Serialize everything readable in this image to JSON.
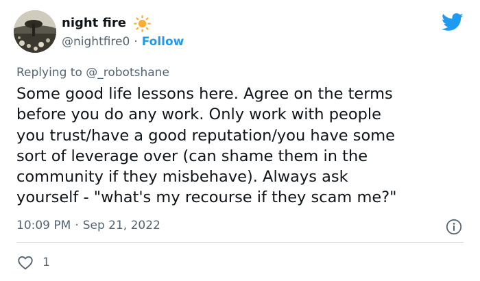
{
  "author": {
    "display_name": "night fire",
    "handle": "@nightfire0",
    "separator": "·",
    "follow_label": "Follow"
  },
  "reply_context": {
    "prefix": "Replying to",
    "mention": "@_robotshane"
  },
  "tweet": {
    "text": "Some good life lessons here. Agree on the terms\nbefore you do any work. Only work with people\nyou trust/have a good reputation/you have some\nsort of leverage over (can shame them in the\ncommunity if they misbehave). Always ask\nyourself - \"what's my recourse if they scam me?\"",
    "time": "10:09 PM",
    "date_separator": "·",
    "date": "Sep 21, 2022"
  },
  "actions": {
    "like_count": "1"
  },
  "icons": {
    "emoji": "sun-icon",
    "brand": "twitter-bird-icon",
    "info": "info-icon",
    "like": "heart-icon"
  },
  "colors": {
    "accent": "#1d9bf0",
    "text_primary": "#0f1419",
    "text_secondary": "#536471",
    "sun": "#ffac33",
    "divider": "#cfd9de"
  }
}
